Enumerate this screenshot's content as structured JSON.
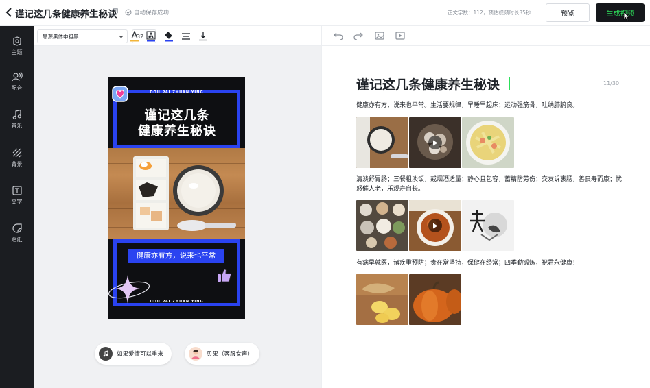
{
  "header": {
    "title": "谨记这几条健康养生秘诀",
    "autosave": "自动保存成功",
    "word_count": "正文字数：112，预估视频时长35秒",
    "preview_label": "预览",
    "generate_label": "生成视频"
  },
  "sidebar": {
    "items": [
      {
        "label": "主题",
        "icon": "theme-icon"
      },
      {
        "label": "配音",
        "icon": "voice-icon"
      },
      {
        "label": "音乐",
        "icon": "music-icon"
      },
      {
        "label": "背景",
        "icon": "background-icon"
      },
      {
        "label": "文字",
        "icon": "text-icon"
      },
      {
        "label": "贴纸",
        "icon": "sticker-icon"
      }
    ]
  },
  "toolbar": {
    "font_family": "思源黑体中粗黑",
    "font_size": "32"
  },
  "poster": {
    "banner_text": "DOU PAI ZHUAN YING",
    "title": "谨记这几条\n健康养生秘诀",
    "caption": "健康亦有方，说来也平常"
  },
  "audio": {
    "music": "如果爱情可以重来",
    "voice": "贝果（客服女声）"
  },
  "document": {
    "heading": "谨记这几条健康养生秘诀",
    "counter": "11/30",
    "paragraphs": [
      "健康亦有方，说来也平常。生活要规律，早睡早起床；运动强筋骨，吐纳肺腑良。",
      "清淡舒胃肠；三餐粗淡饭，戒烟酒适量；静心且包容，蓄精防劳伤；交友诉衷肠，善良寿而康；忧怒催人老，乐观寿自长。",
      "有病早就医，诸疾重预防；贵在常坚持，保健在经常；四季勤锻炼，祝君永健康！"
    ]
  },
  "colors": {
    "accent_green": "#2ddf5a",
    "poster_blue": "#2a43f0",
    "sidebar_bg": "#1b1d21"
  }
}
